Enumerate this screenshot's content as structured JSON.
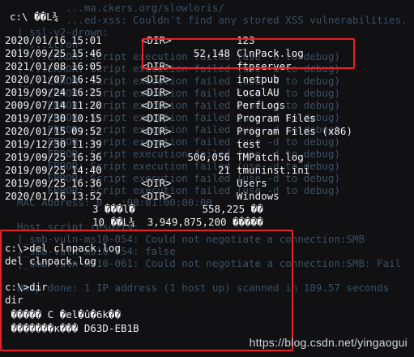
{
  "background_lines": [
    "          ...ma.ckers.org/slowloris/",
    "          ...ed-xss: Couldn't find any stored XSS vulnerabilities.",
    "  |_ssl-v2-drown:",
    "  |_...icron-                                     ",
    "  |_...ERROR: Script execution failed (use -d to debug)",
    "  |_...ERROR: Script execution failed (use -d to debug)",
    "  |_...ERROR: Script execution failed (use -d to debug)",
    "  |_...ERROR: Script execution failed (use -d to debug)",
    "  |_...ERROR: Script execution failed (use -d to debug)",
    "  |_...ERROR: Script execution failed (use -d to debug)",
    "  |_...ERROR: Script execution failed (use -d to debug)",
    "  |_...ERROR: Script execution failed (use -d to debug)",
    "  |_...ERROR: Script execution failed (use -d to debug)",
    "  |_...ERROR: Script execution failed (use -d to debug)",
    "  |_...ERROR: Script execution failed (use -d to debug)",
    "  |_...ERROR: Script execution failed (use -d to debug)",
    "  MAC Address: 0...:08:01:00:00:00",
    "",
    "  Host script results:",
    "  |_smb-vuln-ms10-054: Could not negotiate a connection:SMB",
    "  |_smb-vuln-ms10-054: false",
    "  |_smb-vuln-ms10-061: Could not negotiate a connection:SMB: Fail",
    "",
    "  Nmap done: 1 IP address (1 host up) scanned in 109.57 seconds",
    "",
    ""
  ],
  "header": {
    "prompt_dir": "c:\\ ��L¾"
  },
  "dir_listing": [
    {
      "date": "2020/01/16",
      "time": "15:01",
      "type": "<DIR>",
      "size": "",
      "name": "123"
    },
    {
      "date": "2019/09/25",
      "time": "15:46",
      "type": "",
      "size": "52,148",
      "name": "ClnPack.log"
    },
    {
      "date": "2021/01/08",
      "time": "16:05",
      "type": "<DIR>",
      "size": "",
      "name": "ftpserver"
    },
    {
      "date": "2020/01/07",
      "time": "16:45",
      "type": "<DIR>",
      "size": "",
      "name": "inetpub"
    },
    {
      "date": "2019/09/24",
      "time": "16:25",
      "type": "<DIR>",
      "size": "",
      "name": "LocalAU"
    },
    {
      "date": "2009/07/14",
      "time": "11:20",
      "type": "<DIR>",
      "size": "",
      "name": "PerfLogs"
    },
    {
      "date": "2019/07/30",
      "time": "10:15",
      "type": "<DIR>",
      "size": "",
      "name": "Program Files"
    },
    {
      "date": "2020/01/15",
      "time": "09:52",
      "type": "<DIR>",
      "size": "",
      "name": "Program Files (x86)"
    },
    {
      "date": "2019/12/30",
      "time": "11:39",
      "type": "<DIR>",
      "size": "",
      "name": "test"
    },
    {
      "date": "2019/09/25",
      "time": "16:36",
      "type": "",
      "size": "506,056",
      "name": "TMPatch.log"
    },
    {
      "date": "2019/09/25",
      "time": "14:40",
      "type": "",
      "size": "21",
      "name": "tmuninst.ini"
    },
    {
      "date": "2019/09/25",
      "time": "16:36",
      "type": "<DIR>",
      "size": "",
      "name": "Users"
    },
    {
      "date": "2020/01/16",
      "time": "13:52",
      "type": "<DIR>",
      "size": "",
      "name": "Windows"
    }
  ],
  "summary": {
    "files_line": "3 ���l�           558,225 ��",
    "dirs_line": "10 ��L¾  3,949,875,200 �����"
  },
  "commands": {
    "cmd1": "c:\\>del clnpack.log",
    "cmd1_echo": "del clnpack.log",
    "blank": "",
    "cmd2": "c:\\>dir",
    "cmd2_echo": "dir",
    "vol_line1": " ����� C �el�û�6k��",
    "vol_line2": " �������κ��� D63D-EB1B"
  },
  "watermark": "https://blog.csdn.net/yingaogui",
  "colors": {
    "terminal_bg": "#111114",
    "terminal_text": "#f0f0f0",
    "highlight_red": "#e5232a",
    "background_log": "#3f5668"
  }
}
